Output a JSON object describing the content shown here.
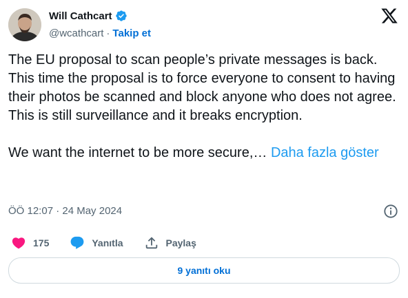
{
  "author": {
    "name": "Will Cathcart",
    "handle": "@wcathcart",
    "separator": "·",
    "follow_label": "Takip et"
  },
  "tweet": {
    "text": "The EU proposal to scan people’s private messages is back.  This time the proposal is to force everyone to consent to having their photos be scanned and block anyone who does not agree. This is still surveillance and it breaks encryption.\n\nWe want the internet to be more secure,…",
    "show_more": "Daha fazla göster",
    "timestamp": "ÖÖ 12:07 · 24 May 2024"
  },
  "actions": {
    "like_count": "175",
    "reply_label": "Yanıtla",
    "share_label": "Paylaş"
  },
  "replies_button": "9 yanıtı oku",
  "colors": {
    "text": "#0f1419",
    "secondary": "#536471",
    "link": "#1d9bf0",
    "heart": "#f91880",
    "reply_icon": "#1d9bf0",
    "verified": "#1d9bf0"
  },
  "icons": [
    "avatar",
    "verified-icon",
    "x-logo-icon",
    "info-icon",
    "heart-icon",
    "reply-icon",
    "share-icon"
  ]
}
